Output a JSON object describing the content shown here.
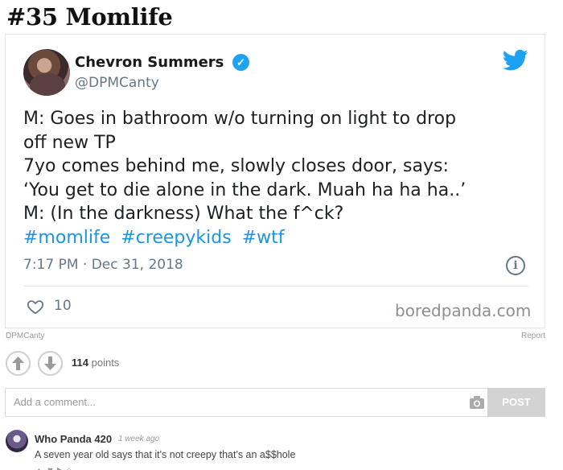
{
  "page": {
    "title": "#35 Momlife"
  },
  "tweet": {
    "author_name": "Chevron Summers",
    "author_handle": "@DPMCanty",
    "text_lines": [
      "M: Goes in bathroom w/o turning on light to drop",
      "off new TP",
      "7yo comes behind me, slowly closes door, says:",
      "‘You get to die alone in the dark. Muah ha ha ha..’",
      "M: (In the darkness) What the f^ck?"
    ],
    "hashtags": [
      "#momlife",
      "#creepykids",
      "#wtf"
    ],
    "timestamp": "7:17 PM · Dec 31, 2018",
    "likes": "10",
    "watermark": "boredpanda.com",
    "icons": [
      "verified-icon",
      "twitter-icon",
      "info-icon",
      "heart-icon"
    ],
    "colors": {
      "link": "#1b95e0",
      "verified": "#1da1f2",
      "muted": "#657786"
    }
  },
  "credit": {
    "source": "DPMCanty",
    "report_label": "Report"
  },
  "votes": {
    "points_value": "114",
    "points_label": "points"
  },
  "comment_box": {
    "placeholder": "Add a comment...",
    "post_label": "POST"
  },
  "comments": [
    {
      "author": "Who Panda 420",
      "time": "1 week ago",
      "text": "A seven year old says that it's not creepy that's an a$$hole"
    }
  ]
}
